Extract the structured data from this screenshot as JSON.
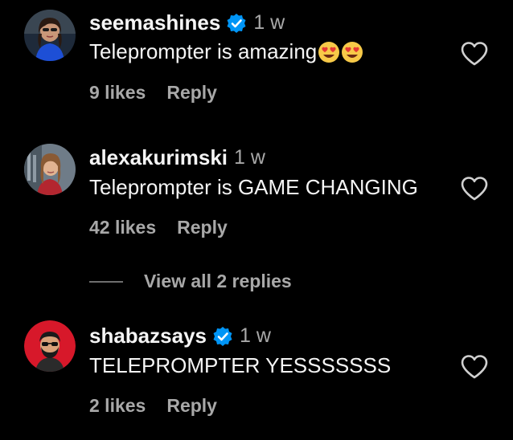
{
  "colors": {
    "background": "#000000",
    "primary_text": "#f5f5f5",
    "secondary_text": "#a8a8a8",
    "verified_blue": "#0095f6"
  },
  "comments": [
    {
      "username": "seemashines",
      "verified": true,
      "time": "1 w",
      "text": "Teleprompter is amazing",
      "emojis": [
        "heart-eyes-emoji",
        "heart-eyes-emoji"
      ],
      "likes": "9 likes",
      "reply_label": "Reply",
      "heart_icon": "heart-outline-icon"
    },
    {
      "username": "alexakurimski",
      "verified": false,
      "time": "1 w",
      "text": "Teleprompter is GAME CHANGING",
      "likes": "42 likes",
      "reply_label": "Reply",
      "heart_icon": "heart-outline-icon",
      "view_replies": "View all 2 replies"
    },
    {
      "username": "shabazsays",
      "verified": true,
      "time": "1 w",
      "text": "TELEPROMPTER YESSSSSSS",
      "likes": "2 likes",
      "reply_label": "Reply",
      "heart_icon": "heart-outline-icon"
    }
  ]
}
